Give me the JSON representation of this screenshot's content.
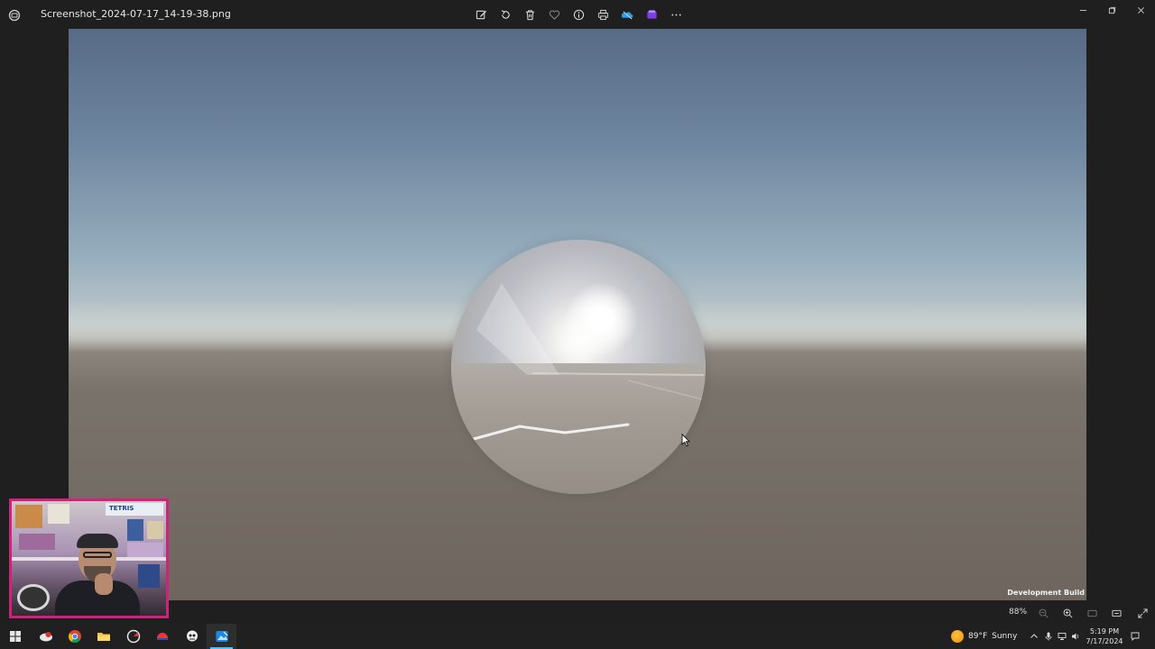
{
  "titlebar": {
    "file_name": "Screenshot_2024-07-17_14-19-38.png",
    "toolbar_icons": [
      "edit-icon",
      "rotate-icon",
      "delete-icon",
      "favorite-icon",
      "info-icon",
      "print-icon",
      "onedrive-icon",
      "clipchamp-icon",
      "more-icon"
    ],
    "window_controls": [
      "minimize-icon",
      "maximize-icon",
      "close-icon"
    ]
  },
  "viewer": {
    "overlay_label": "Development Build"
  },
  "statusbar": {
    "zoom": "88%"
  },
  "webcam": {
    "poster_text": "TETRIS",
    "border_color": "#d61f7a"
  },
  "taskbar": {
    "apps": [
      "start-icon",
      "app-icon",
      "chrome-icon",
      "file-explorer-icon",
      "app-icon",
      "app-icon",
      "app-icon",
      "photos-icon"
    ],
    "weather": {
      "temperature": "89°F",
      "condition": "Sunny"
    },
    "clock": {
      "time": "5:19 PM",
      "date": "7/17/2024"
    }
  },
  "colors": {
    "accent": "#4cc2ff",
    "taskbar_bg": "#202020",
    "app_bg": "#1f1f1f"
  }
}
